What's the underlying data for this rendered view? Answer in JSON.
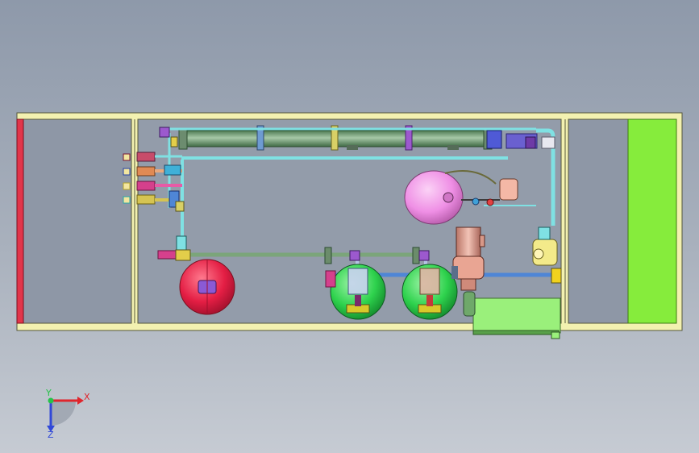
{
  "viewport": {
    "background_top": "#8e99aa",
    "background_bottom": "#c6cbd3"
  },
  "colors": {
    "frame": "#f3f1b0",
    "frame_edge": "#55563a",
    "red_panel": "#e2354a",
    "green_panel": "#86ec3c",
    "membrane_housing": "#6f9a73",
    "pressure_tank": "#e41e44",
    "filter_vessels": "#2ed24d",
    "drum": "#ef8fe5",
    "pump_motor": "#e9a593",
    "pipe_cyan": "#7fe1e3",
    "pipe_green": "#7ba57a",
    "pipe_blue": "#4f86d6",
    "valve_purple": "#9c59ce",
    "valve_yellow": "#e3ce4a",
    "base_skid": "#9af07b"
  },
  "icons": {
    "axis_triad": "axis-triad-icon",
    "port_fittings": "port-fitting-icon"
  },
  "triad": {
    "x_label": "X",
    "y_label": "Y",
    "z_label": "Z",
    "x_color": "#e0252c",
    "y_color": "#27c24a",
    "z_color": "#3048d8"
  }
}
